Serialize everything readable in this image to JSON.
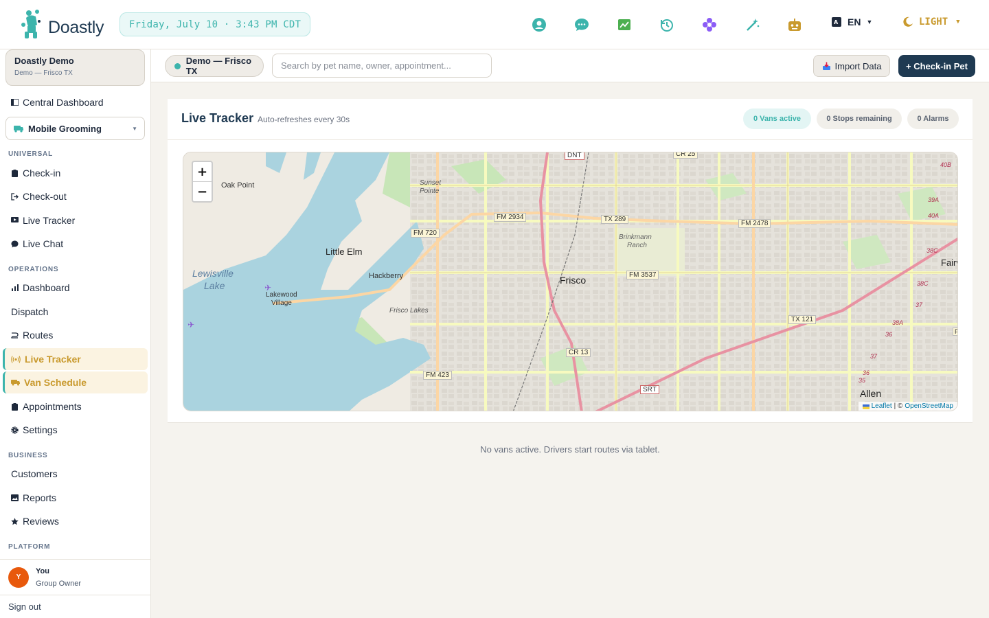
{
  "brand": {
    "name": "Doastly"
  },
  "header": {
    "datetime": "Friday, July 10 · 3:43 PM CDT",
    "icons": [
      "support-icon",
      "chat-icon",
      "analytics-icon",
      "history-icon",
      "flower-icon",
      "magic-wand-icon",
      "robot-icon"
    ],
    "language": "EN",
    "theme": "LIGHT"
  },
  "sidebar": {
    "org_name": "Doastly Demo",
    "org_location": "Demo — Frisco TX",
    "central_dashboard": "Central Dashboard",
    "module_select": "Mobile Grooming",
    "sections": {
      "universal": "UNIVERSAL",
      "operations": "OPERATIONS",
      "business": "BUSINESS",
      "platform": "PLATFORM"
    },
    "universal_items": [
      "Check-in",
      "Check-out",
      "Live Tracker",
      "Live Chat"
    ],
    "operations_items": [
      "Dashboard",
      "Dispatch",
      "Routes",
      "Live Tracker",
      "Van Schedule",
      "Appointments",
      "Settings"
    ],
    "business_items": [
      "Customers",
      "Reports",
      "Reviews"
    ],
    "user": {
      "initial": "Y",
      "name": "You",
      "role": "Group Owner"
    },
    "sign_out": "Sign out"
  },
  "toolbar": {
    "location": "Demo — Frisco TX",
    "search_placeholder": "Search by pet name, owner, appointment...",
    "import_label": "Import Data",
    "checkin_label": "+ Check-in Pet"
  },
  "tracker": {
    "title": "Live Tracker",
    "subtitle": "Auto-refreshes every 30s",
    "stats": {
      "vans_active": "0 Vans active",
      "stops_remaining": "0 Stops remaining",
      "alarms": "0 Alarms"
    },
    "empty_message": "No vans active. Drivers start routes via tablet."
  },
  "map": {
    "zoom_in": "+",
    "zoom_out": "−",
    "attribution_leaflet": "Leaflet",
    "attribution_sep": "| ©",
    "attribution_osm": "OpenStreetMap",
    "labels": {
      "oak_point": "Oak Point",
      "sunset": "Sunset",
      "pointe": "Pointe",
      "little_elm": "Little Elm",
      "lewisville": "Lewisville",
      "lake": "Lake",
      "hackberry": "Hackberry",
      "lakewood": "Lakewood",
      "village": "Village",
      "frisco_lakes": "Frisco Lakes",
      "frisco": "Frisco",
      "brinkmann": "Brinkmann",
      "ranch": "Ranch",
      "allen": "Allen",
      "fairview": "Fairv"
    },
    "shields": {
      "dnt": "DNT",
      "cr25": "CR 25",
      "fm2934": "FM 2934",
      "tx289": "TX 289",
      "fm2478": "FM 2478",
      "fm720": "FM 720",
      "fm3537": "FM 3537",
      "tx121": "TX 121",
      "cr13": "CR 13",
      "fm423": "FM 423",
      "srt": "SRT"
    },
    "exits": [
      "40B",
      "39A",
      "40A",
      "38C",
      "38C",
      "37",
      "38A",
      "36",
      "37",
      "36",
      "35",
      "F"
    ]
  },
  "colors": {
    "accent_teal": "#3cb4ac",
    "accent_gold": "#c99a2e",
    "navy": "#1f3a52",
    "water": "#aad3df",
    "road_yellow": "#f7fabf",
    "road_orange": "#fcd6a4",
    "highway": "#e892a2"
  }
}
